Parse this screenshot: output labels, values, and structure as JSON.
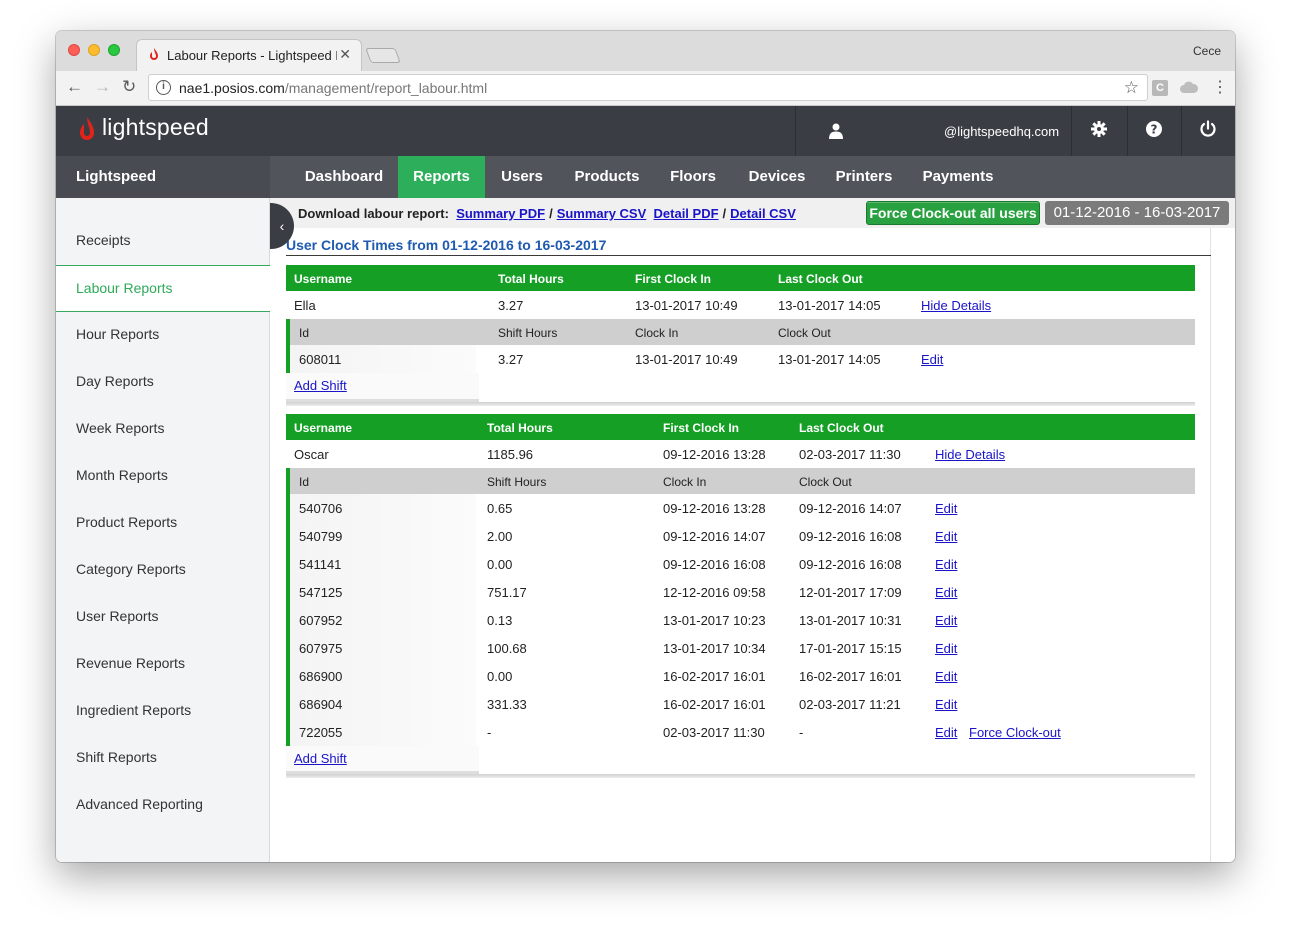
{
  "browser": {
    "tab_title": "Labour Reports - Lightspeed R",
    "tab_close": "✕",
    "profile_name": "Cece",
    "url_host": "nae1.posios.com",
    "url_path": "/management/report_labour.html"
  },
  "header": {
    "logo_text": "lightspeed",
    "user_email": "@lightspeedhq.com",
    "brand_color": "#e2231a"
  },
  "nav": {
    "brand": "Lightspeed",
    "items": [
      "Dashboard",
      "Reports",
      "Users",
      "Products",
      "Floors",
      "Devices",
      "Printers",
      "Payments"
    ],
    "active": "Reports",
    "active_color": "#2dae5a"
  },
  "sidebar": {
    "items": [
      "Receipts",
      "Labour Reports",
      "Hour Reports",
      "Day Reports",
      "Week Reports",
      "Month Reports",
      "Product Reports",
      "Category Reports",
      "User Reports",
      "Revenue Reports",
      "Ingredient Reports",
      "Shift Reports",
      "Advanced Reporting"
    ],
    "active": "Labour Reports"
  },
  "download": {
    "label": "Download labour report:",
    "links": [
      "Summary PDF",
      "Summary CSV",
      "Detail PDF",
      "Detail CSV"
    ],
    "separator": "/"
  },
  "actions": {
    "force_all": "Force Clock-out all users",
    "date_range": "01-12-2016 - 16-03-2017"
  },
  "report": {
    "title": "User Clock Times from 01-12-2016 to 16-03-2017",
    "user_headers": [
      "Username",
      "Total Hours",
      "First Clock In",
      "Last Clock Out"
    ],
    "shift_headers": [
      "Id",
      "Shift Hours",
      "Clock In",
      "Clock Out"
    ],
    "hide_details": "Hide Details",
    "edit": "Edit",
    "force_clockout": "Force Clock-out",
    "add_shift": "Add Shift",
    "users": [
      {
        "username": "Ella",
        "total_hours": "3.27",
        "first_in": "13-01-2017 10:49",
        "last_out": "13-01-2017 14:05",
        "shifts": [
          {
            "id": "608011",
            "hours": "3.27",
            "in": "13-01-2017 10:49",
            "out": "13-01-2017 14:05"
          }
        ]
      },
      {
        "username": "Oscar",
        "total_hours": "1185.96",
        "first_in": "09-12-2016 13:28",
        "last_out": "02-03-2017 11:30",
        "shifts": [
          {
            "id": "540706",
            "hours": "0.65",
            "in": "09-12-2016 13:28",
            "out": "09-12-2016 14:07"
          },
          {
            "id": "540799",
            "hours": "2.00",
            "in": "09-12-2016 14:07",
            "out": "09-12-2016 16:08"
          },
          {
            "id": "541141",
            "hours": "0.00",
            "in": "09-12-2016 16:08",
            "out": "09-12-2016 16:08"
          },
          {
            "id": "547125",
            "hours": "751.17",
            "in": "12-12-2016 09:58",
            "out": "12-01-2017 17:09"
          },
          {
            "id": "607952",
            "hours": "0.13",
            "in": "13-01-2017 10:23",
            "out": "13-01-2017 10:31"
          },
          {
            "id": "607975",
            "hours": "100.68",
            "in": "13-01-2017 10:34",
            "out": "17-01-2017 15:15"
          },
          {
            "id": "686900",
            "hours": "0.00",
            "in": "16-02-2017 16:01",
            "out": "16-02-2017 16:01"
          },
          {
            "id": "686904",
            "hours": "331.33",
            "in": "16-02-2017 16:01",
            "out": "02-03-2017 11:21"
          },
          {
            "id": "722055",
            "hours": "-",
            "in": "02-03-2017 11:30",
            "out": "-",
            "force": true
          }
        ]
      }
    ]
  }
}
